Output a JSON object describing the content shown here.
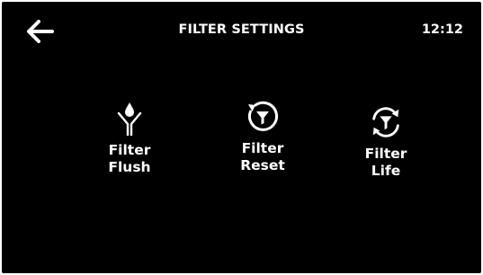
{
  "header": {
    "back_icon": "arrow-left-icon",
    "title": "FILTER SETTINGS",
    "time": "12:12"
  },
  "tiles": [
    {
      "icon": "filter-flush-icon",
      "line1": "Filter",
      "line2": "Flush"
    },
    {
      "icon": "filter-reset-icon",
      "line1": "Filter",
      "line2": "Reset"
    },
    {
      "icon": "filter-life-icon",
      "line1": "Filter",
      "line2": "Life"
    }
  ],
  "colors": {
    "background": "#000000",
    "foreground": "#ffffff"
  }
}
